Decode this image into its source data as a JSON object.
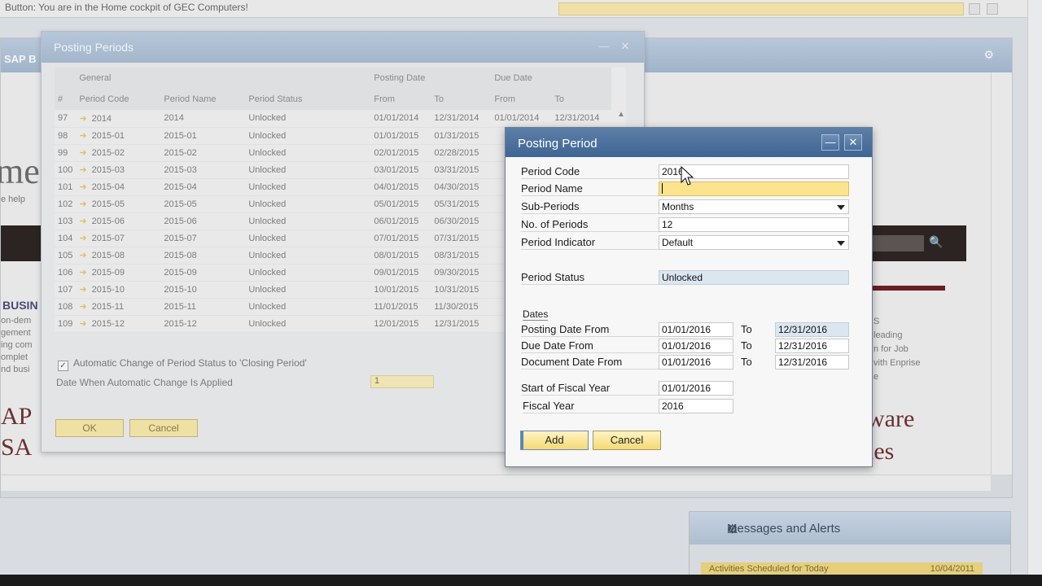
{
  "topbar": {
    "message": "Button: You are in the Home cockpit of GEC Computers!"
  },
  "cockpit": {
    "header_fragment": "SAP B",
    "bg_big": "me",
    "bg_small": "e help",
    "bg_heading": "BUSIN",
    "bg_lines": [
      "on-dem",
      "gement",
      "ing com",
      "omplet",
      "nd busi"
    ],
    "bg_right_lines": [
      "S",
      "leading",
      "n for Job",
      "vith Enprise",
      "e"
    ],
    "bg_ap": [
      "AP",
      "SA"
    ],
    "bg_ware": [
      "ware",
      "ies"
    ]
  },
  "messages_panel": {
    "title": "Messages and Alerts",
    "row_text": "Activities Scheduled for Today",
    "row_date": "10/04/2011"
  },
  "posting_periods": {
    "title": "Posting Periods",
    "group_headers": {
      "general": "General",
      "posting_date": "Posting Date",
      "due_date": "Due Date"
    },
    "columns": {
      "num": "#",
      "code": "Period Code",
      "name": "Period Name",
      "status": "Period Status",
      "from": "From",
      "to": "To"
    },
    "rows": [
      {
        "num": "97",
        "code": "2014",
        "name": "2014",
        "status": "Unlocked",
        "pfrom": "01/01/2014",
        "pto": "12/31/2014",
        "dfrom": "01/01/2014",
        "dto": "12/31/2014"
      },
      {
        "num": "98",
        "code": "2015-01",
        "name": "2015-01",
        "status": "Unlocked",
        "pfrom": "01/01/2015",
        "pto": "01/31/2015",
        "dfrom": "",
        "dto": ""
      },
      {
        "num": "99",
        "code": "2015-02",
        "name": "2015-02",
        "status": "Unlocked",
        "pfrom": "02/01/2015",
        "pto": "02/28/2015",
        "dfrom": "",
        "dto": ""
      },
      {
        "num": "100",
        "code": "2015-03",
        "name": "2015-03",
        "status": "Unlocked",
        "pfrom": "03/01/2015",
        "pto": "03/31/2015",
        "dfrom": "",
        "dto": ""
      },
      {
        "num": "101",
        "code": "2015-04",
        "name": "2015-04",
        "status": "Unlocked",
        "pfrom": "04/01/2015",
        "pto": "04/30/2015",
        "dfrom": "",
        "dto": ""
      },
      {
        "num": "102",
        "code": "2015-05",
        "name": "2015-05",
        "status": "Unlocked",
        "pfrom": "05/01/2015",
        "pto": "05/31/2015",
        "dfrom": "",
        "dto": ""
      },
      {
        "num": "103",
        "code": "2015-06",
        "name": "2015-06",
        "status": "Unlocked",
        "pfrom": "06/01/2015",
        "pto": "06/30/2015",
        "dfrom": "",
        "dto": ""
      },
      {
        "num": "104",
        "code": "2015-07",
        "name": "2015-07",
        "status": "Unlocked",
        "pfrom": "07/01/2015",
        "pto": "07/31/2015",
        "dfrom": "",
        "dto": ""
      },
      {
        "num": "105",
        "code": "2015-08",
        "name": "2015-08",
        "status": "Unlocked",
        "pfrom": "08/01/2015",
        "pto": "08/31/2015",
        "dfrom": "",
        "dto": ""
      },
      {
        "num": "106",
        "code": "2015-09",
        "name": "2015-09",
        "status": "Unlocked",
        "pfrom": "09/01/2015",
        "pto": "09/30/2015",
        "dfrom": "",
        "dto": ""
      },
      {
        "num": "107",
        "code": "2015-10",
        "name": "2015-10",
        "status": "Unlocked",
        "pfrom": "10/01/2015",
        "pto": "10/31/2015",
        "dfrom": "",
        "dto": ""
      },
      {
        "num": "108",
        "code": "2015-11",
        "name": "2015-11",
        "status": "Unlocked",
        "pfrom": "11/01/2015",
        "pto": "11/30/2015",
        "dfrom": "",
        "dto": ""
      },
      {
        "num": "109",
        "code": "2015-12",
        "name": "2015-12",
        "status": "Unlocked",
        "pfrom": "12/01/2015",
        "pto": "12/31/2015",
        "dfrom": "",
        "dto": ""
      }
    ],
    "auto_change_label": "Automatic Change of Period Status to 'Closing Period'",
    "date_applied_label": "Date When Automatic Change Is Applied",
    "date_applied_value": "1",
    "ok_label": "OK",
    "cancel_label": "Cancel"
  },
  "dialog": {
    "title": "Posting Period",
    "labels": {
      "period_code": "Period Code",
      "period_name": "Period Name",
      "sub_periods": "Sub-Periods",
      "no_of_periods": "No. of Periods",
      "period_indicator": "Period Indicator",
      "period_status": "Period Status",
      "dates": "Dates",
      "posting_date_from": "Posting Date From",
      "due_date_from": "Due Date From",
      "document_date_from": "Document Date From",
      "to": "To",
      "start_of_fiscal_year": "Start of Fiscal Year",
      "fiscal_year": "Fiscal Year"
    },
    "values": {
      "period_code": "2016",
      "period_name": "",
      "sub_periods": "Months",
      "no_of_periods": "12",
      "period_indicator": "Default",
      "period_status": "Unlocked",
      "posting_from": "01/01/2016",
      "posting_to": "12/31/2016",
      "due_from": "01/01/2016",
      "due_to": "12/31/2016",
      "doc_from": "01/01/2016",
      "doc_to": "12/31/2016",
      "fiscal_start": "01/01/2016",
      "fiscal_year": "2016"
    },
    "add_label": "Add",
    "cancel_label": "Cancel"
  }
}
